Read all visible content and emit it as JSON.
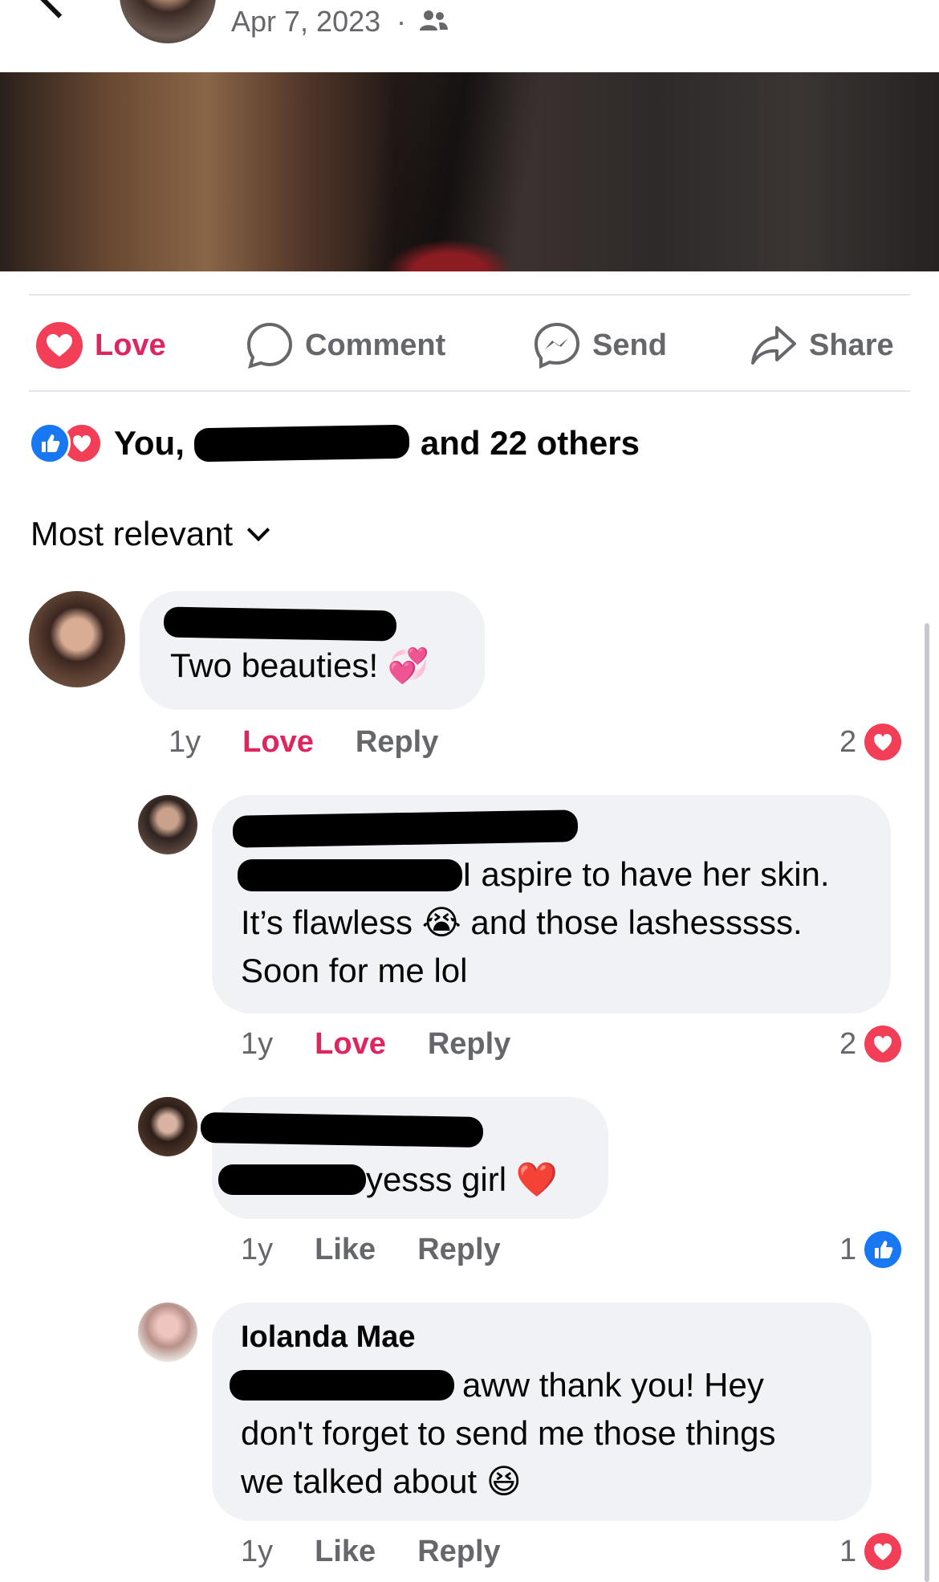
{
  "header": {
    "date": "Apr 7, 2023",
    "separator": "·",
    "audience_icon": "friends-icon"
  },
  "actions": {
    "love": "Love",
    "comment": "Comment",
    "send": "Send",
    "share": "Share"
  },
  "reactions": {
    "you": "You,",
    "others": "and 22 others"
  },
  "sort": {
    "label": "Most relevant"
  },
  "comments": [
    {
      "text": "Two beauties!",
      "emoji": "💞",
      "time": "1y",
      "action": "Love",
      "reply": "Reply",
      "count": "2",
      "reaction": "love"
    },
    {
      "line1": "I aspire to have her skin.",
      "line2a": "It’s flawless",
      "emoji": "😭",
      "line2b": "and those lashesssss.",
      "line3": "Soon for me lol",
      "time": "1y",
      "action": "Love",
      "reply": "Reply",
      "count": "2",
      "reaction": "love"
    },
    {
      "text": "yesss girl",
      "emoji": "❤️",
      "time": "1y",
      "action": "Like",
      "reply": "Reply",
      "count": "1",
      "reaction": "like"
    },
    {
      "author": "Iolanda Mae",
      "line1": "aww thank you! Hey",
      "line2": "don't forget to send me those things",
      "line3": "we talked about",
      "emoji": "😆",
      "time": "1y",
      "action": "Like",
      "reply": "Reply",
      "count": "1",
      "reaction": "love"
    }
  ],
  "colors": {
    "love": "#e0245e",
    "like": "#1877f2",
    "bubble": "#f0f2f5",
    "secondary_text": "#65676b"
  }
}
